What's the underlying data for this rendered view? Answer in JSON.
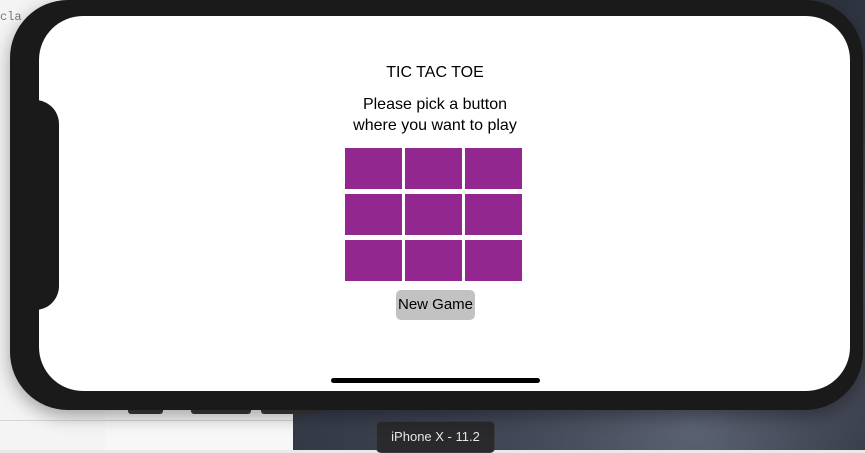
{
  "backdrop": {
    "code_snippet": "cla",
    "simulator_label": "iPhone X - 11.2"
  },
  "app": {
    "title": "TIC TAC TOE",
    "subtitle_line1": "Please pick a button",
    "subtitle_line2": "where you want to play",
    "board": {
      "cells": [
        "",
        "",
        "",
        "",
        "",
        "",
        "",
        "",
        ""
      ],
      "cell_color": "#92278f"
    },
    "new_game_label": "New Game",
    "new_game_color": "#c2c2c2"
  }
}
